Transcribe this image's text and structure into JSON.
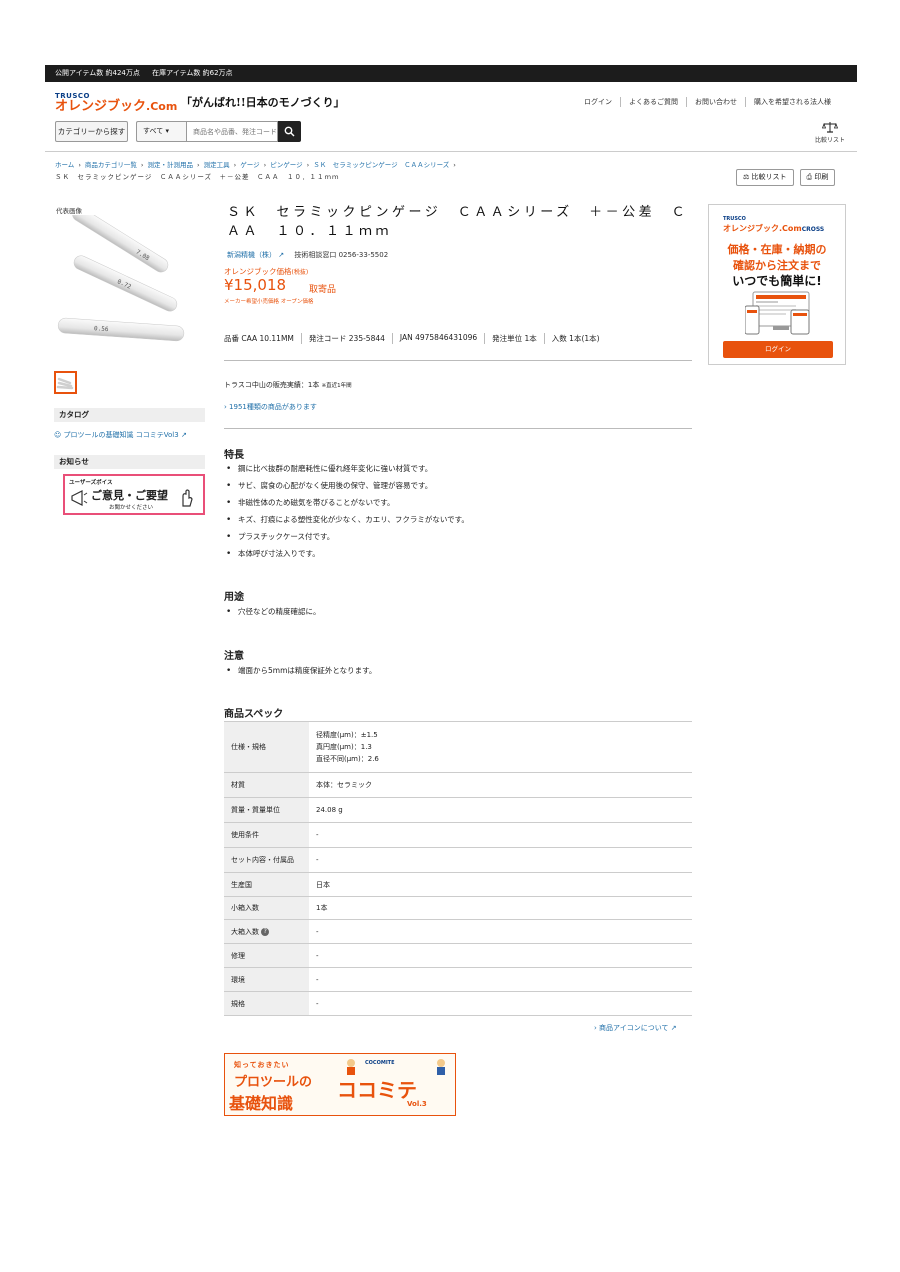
{
  "topbar": {
    "items": [
      "公開アイテム数 約424万点",
      "在庫アイテム数 約62万点"
    ]
  },
  "header": {
    "logo_trusco": "TRUSCO",
    "logo_main": "オレンジブック",
    "logo_com": ".Com",
    "slogan": "「がんばれ!!日本のモノづくり」",
    "nav": [
      "ログイン",
      "よくあるご質問",
      "お問い合わせ",
      "購入を希望される法人様"
    ],
    "category_button": "カテゴリーから探す",
    "search_scope": "すべて",
    "search_placeholder": "商品名や品番、発注コード",
    "compare_label": "比較リスト"
  },
  "breadcrumb": {
    "items": [
      "ホーム",
      "商品カテゴリ一覧",
      "測定・計測用品",
      "測定工具",
      "ゲージ",
      "ピンゲージ",
      "ＳＫ　セラミックピンゲージ　ＣＡＡシリーズ"
    ],
    "current": "ＳＫ　セラミックピンゲージ　ＣＡＡシリーズ　＋－公差　ＣＡＡ　１０．１１ｍｍ"
  },
  "tools": {
    "compare": "比較リスト",
    "print": "印刷"
  },
  "sidebar": {
    "rep_label": "代表画像",
    "catalog_heading": "カタログ",
    "catalog_link": "プロツールの基礎知識 ココミテVol3",
    "news_heading": "お知らせ",
    "voice_top": "ユーザーズボイス",
    "voice_main": "ご意見・ご要望",
    "voice_sub": "お聞かせください",
    "pin_labels": [
      "7.08",
      "0.72",
      "0.56"
    ]
  },
  "product": {
    "title": "ＳＫ　セラミックピンゲージ　ＣＡＡシリーズ　＋－公差　ＣＡＡ　１０．１１ｍｍ",
    "maker": "新潟精機（株）",
    "tech_contact": "技術相談窓口  0256-33-5502",
    "price_label": "オレンジブック価格",
    "price_tax": "(税抜)",
    "price": "¥15,018",
    "stock_status": "取寄品",
    "maker_price": "メーカー希望小売価格 オープン価格",
    "codes": [
      "品番  CAA 10.11MM",
      "発注コード  235-5844",
      "JAN  4975846431096",
      "発注単位  1本",
      "入数  1本(1本)"
    ],
    "sales": "トラスコ中山の販売実績：1本",
    "sales_note": "※直近1年間",
    "variants_link": "1951種類の商品があります"
  },
  "features": {
    "heading": "特長",
    "items": [
      "鋼に比べ抜群の耐磨耗性に優れ経年変化に強い材質です。",
      "サビ、腐食の心配がなく使用後の保守、管理が容易です。",
      "非磁性体のため磁気を帯びることがないです。",
      "キズ、打痕による塑性変化が少なく、カエリ、フクラミがないです。",
      "プラスチックケース付です。",
      "本体呼び寸法入りです。"
    ]
  },
  "usage": {
    "heading": "用途",
    "items": [
      "穴径などの精度確認に。"
    ]
  },
  "caution": {
    "heading": "注意",
    "items": [
      "端面から5mmは精度保証外となります。"
    ]
  },
  "spec": {
    "heading": "商品スペック",
    "rows": [
      {
        "k": "仕様・規格",
        "v": [
          "径精度(μm)：±1.5",
          "真円度(μm)：1.3",
          "直径不同(μm)：2.6"
        ]
      },
      {
        "k": "材質",
        "v": [
          "本体：セラミック"
        ]
      },
      {
        "k": "質量・質量単位",
        "v": [
          "24.08 g"
        ]
      },
      {
        "k": "使用条件",
        "v": [
          "-"
        ]
      },
      {
        "k": "セット内容・付属品",
        "v": [
          "-"
        ]
      },
      {
        "k": "生産国",
        "v": [
          "日本"
        ]
      },
      {
        "k": "小箱入数",
        "v": [
          "1本"
        ]
      },
      {
        "k": "大箱入数",
        "v": [
          "-"
        ]
      },
      {
        "k": "修理",
        "v": [
          "-"
        ]
      },
      {
        "k": "環境",
        "v": [
          "-"
        ]
      },
      {
        "k": "規格",
        "v": [
          "-"
        ]
      }
    ],
    "help_mark": "?",
    "icon_about": "商品アイコンについて"
  },
  "cocomite": {
    "top": "知っておきたい",
    "line1": "プロツールの",
    "line2": "基礎知識",
    "brand": "ココミテ",
    "vol": "Vol.3",
    "logo": "COCOMITE"
  },
  "cross_ad": {
    "trusco": "TRUSCO",
    "brand": "オレンジブック.Com",
    "cross": "CROSS",
    "line1": "価格・在庫・納期の",
    "line2": "確認から注文まで",
    "line3": "いつでも簡単に!",
    "login": "ログイン"
  },
  "colors": {
    "accent": "#e8520d",
    "link": "#1f6fa8",
    "topbar": "#1c1c1c"
  }
}
